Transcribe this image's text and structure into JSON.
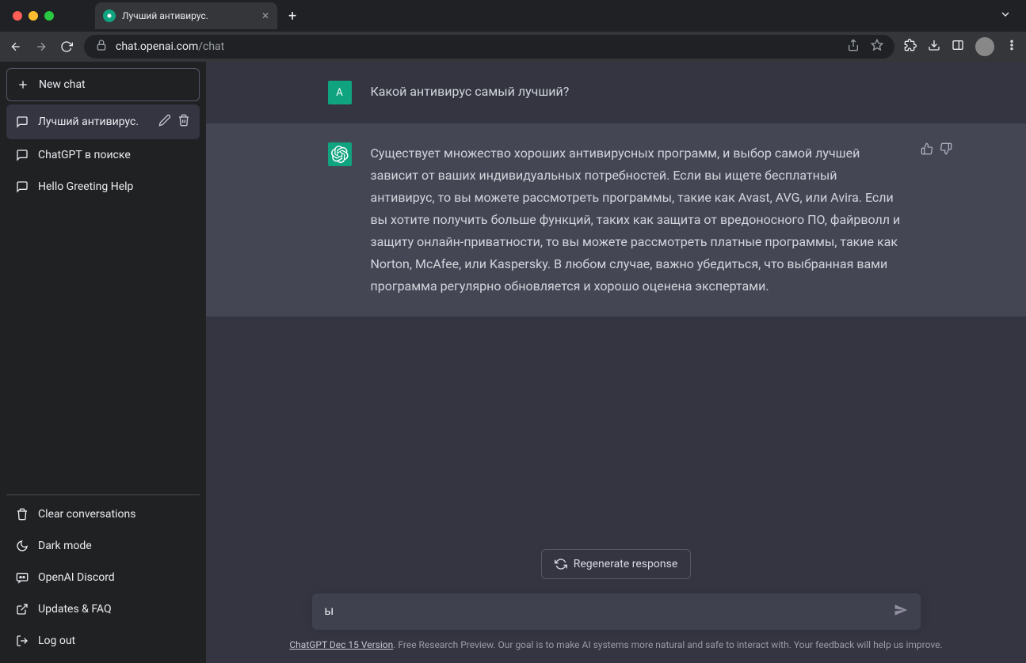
{
  "browser": {
    "tab_title": "Лучший антивирус.",
    "url_domain": "chat.openai.com",
    "url_path": "/chat"
  },
  "sidebar": {
    "new_chat": "New chat",
    "chats": [
      {
        "label": "Лучший антивирус.",
        "active": true
      },
      {
        "label": "ChatGPT в поиске",
        "active": false
      },
      {
        "label": "Hello Greeting Help",
        "active": false
      }
    ],
    "options": {
      "clear": "Clear conversations",
      "dark": "Dark mode",
      "discord": "OpenAI Discord",
      "faq": "Updates & FAQ",
      "logout": "Log out"
    }
  },
  "conversation": {
    "user_initial": "А",
    "user_message": "Какой антивирус самый лучший?",
    "assistant_message": "Существует множество хороших антивирусных программ, и выбор самой лучшей зависит от ваших индивидуальных потребностей. Если вы ищете бесплатный антивирус, то вы можете рассмотреть программы, такие как Avast, AVG, или Avira. Если вы хотите получить больше функций, таких как защита от вредоносного ПО, файрволл и защиту онлайн-приватности, то вы можете рассмотреть платные программы, такие как Norton, McAfee, или Kaspersky. В любом случае, важно убедиться, что выбранная вами программа регулярно обновляется и хорошо оценена экспертами."
  },
  "controls": {
    "regenerate": "Regenerate response",
    "input_value": "ы"
  },
  "footer": {
    "version_link": "ChatGPT Dec 15 Version",
    "note": ". Free Research Preview. Our goal is to make AI systems more natural and safe to interact with. Your feedback will help us improve."
  }
}
